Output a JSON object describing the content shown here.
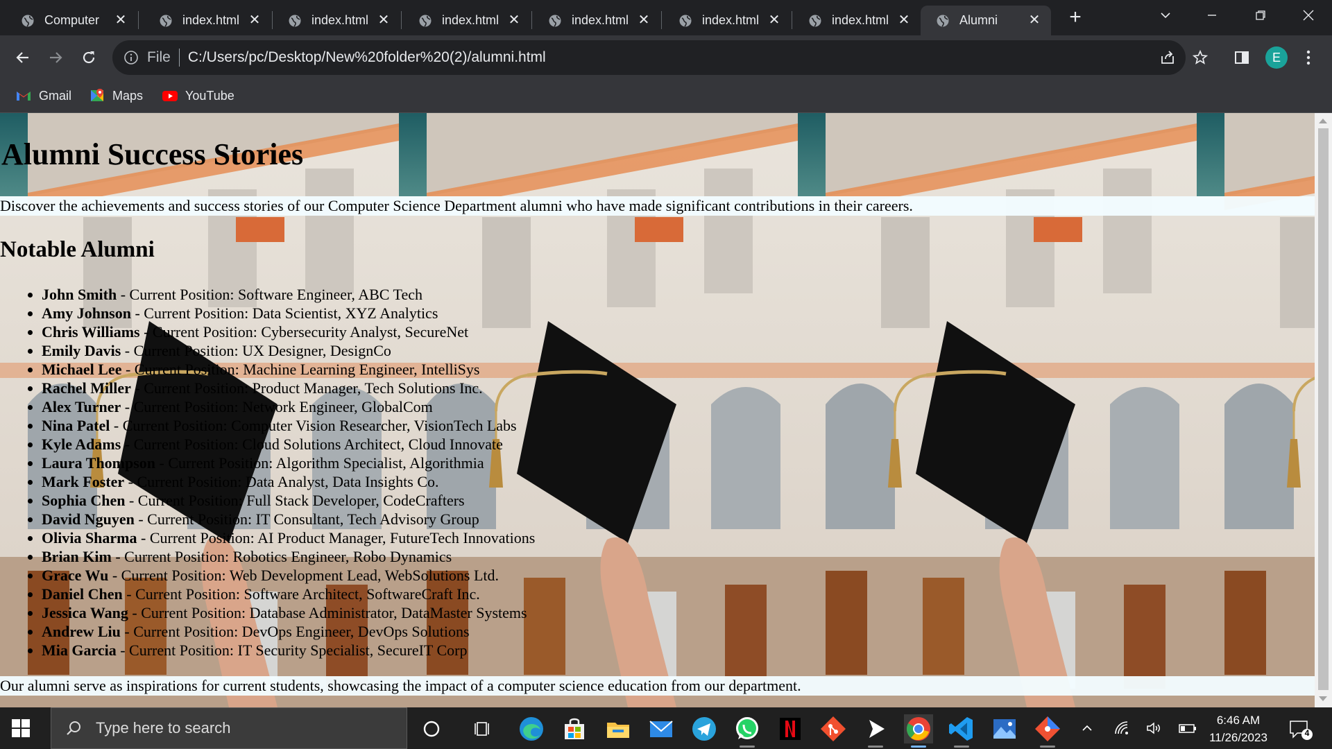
{
  "browser": {
    "tabs": [
      {
        "title": "Computer",
        "active": false
      },
      {
        "title": "index.html",
        "active": false
      },
      {
        "title": "index.html",
        "active": false
      },
      {
        "title": "index.html",
        "active": false
      },
      {
        "title": "index.html",
        "active": false
      },
      {
        "title": "index.html",
        "active": false
      },
      {
        "title": "index.html",
        "active": false
      },
      {
        "title": "Alumni",
        "active": true
      }
    ],
    "address": {
      "scheme_label": "File",
      "url": "C:/Users/pc/Desktop/New%20folder%20(2)/alumni.html"
    },
    "profile_initial": "E",
    "bookmarks": [
      {
        "label": "Gmail",
        "icon": "gmail-icon"
      },
      {
        "label": "Maps",
        "icon": "maps-icon"
      },
      {
        "label": "YouTube",
        "icon": "youtube-icon"
      }
    ]
  },
  "page": {
    "title": "Alumni Success Stories",
    "intro": "Discover the achievements and success stories of our Computer Science Department alumni who have made significant contributions in their careers.",
    "section_heading": "Notable Alumni",
    "alumni": [
      {
        "name": "John Smith",
        "detail": " - Current Position: Software Engineer, ABC Tech"
      },
      {
        "name": "Amy Johnson",
        "detail": " - Current Position: Data Scientist, XYZ Analytics"
      },
      {
        "name": "Chris Williams",
        "detail": " - Current Position: Cybersecurity Analyst, SecureNet"
      },
      {
        "name": "Emily Davis",
        "detail": " - Current Position: UX Designer, DesignCo"
      },
      {
        "name": "Michael Lee",
        "detail": " - Current Position: Machine Learning Engineer, IntelliSys"
      },
      {
        "name": "Rachel Miller",
        "detail": " - Current Position: Product Manager, Tech Solutions Inc."
      },
      {
        "name": "Alex Turner",
        "detail": " - Current Position: Network Engineer, GlobalCom"
      },
      {
        "name": "Nina Patel",
        "detail": " - Current Position: Computer Vision Researcher, VisionTech Labs"
      },
      {
        "name": "Kyle Adams",
        "detail": " - Current Position: Cloud Solutions Architect, Cloud Innovate"
      },
      {
        "name": "Laura Thompson",
        "detail": " - Current Position: Algorithm Specialist, Algorithmia"
      },
      {
        "name": "Mark Foster",
        "detail": " - Current Position: Data Analyst, Data Insights Co."
      },
      {
        "name": "Sophia Chen",
        "detail": " - Current Position: Full Stack Developer, CodeCrafters"
      },
      {
        "name": "David Nguyen",
        "detail": " - Current Position: IT Consultant, Tech Advisory Group"
      },
      {
        "name": "Olivia Sharma",
        "detail": " - Current Position: AI Product Manager, FutureTech Innovations"
      },
      {
        "name": "Brian Kim",
        "detail": " - Current Position: Robotics Engineer, Robo Dynamics"
      },
      {
        "name": "Grace Wu",
        "detail": " - Current Position: Web Development Lead, WebSolutions Ltd."
      },
      {
        "name": "Daniel Chen",
        "detail": " - Current Position: Software Architect, SoftwareCraft Inc."
      },
      {
        "name": "Jessica Wang",
        "detail": " - Current Position: Database Administrator, DataMaster Systems"
      },
      {
        "name": "Andrew Liu",
        "detail": " - Current Position: DevOps Engineer, DevOps Solutions"
      },
      {
        "name": "Mia Garcia",
        "detail": " - Current Position: IT Security Specialist, SecureIT Corp"
      }
    ],
    "outro": "Our alumni serve as inspirations for current students, showcasing the impact of a computer science education from our department."
  },
  "taskbar": {
    "search_placeholder": "Type here to search",
    "apps": [
      "cortana-icon",
      "task-view-icon",
      "edge-icon",
      "store-icon",
      "file-explorer-icon",
      "mail-icon",
      "telegram-icon",
      "whatsapp-icon",
      "netflix-icon",
      "git-icon",
      "media-player-icon",
      "chrome-icon",
      "vscode-icon",
      "photos-icon",
      "git-icon-2"
    ],
    "time": "6:46 AM",
    "date": "11/26/2023",
    "notification_count": "4"
  },
  "colors": {
    "chrome_dark": "#202124",
    "chrome_toolbar": "#35363a",
    "profile": "#1aa39a",
    "taskbar": "#202020"
  }
}
